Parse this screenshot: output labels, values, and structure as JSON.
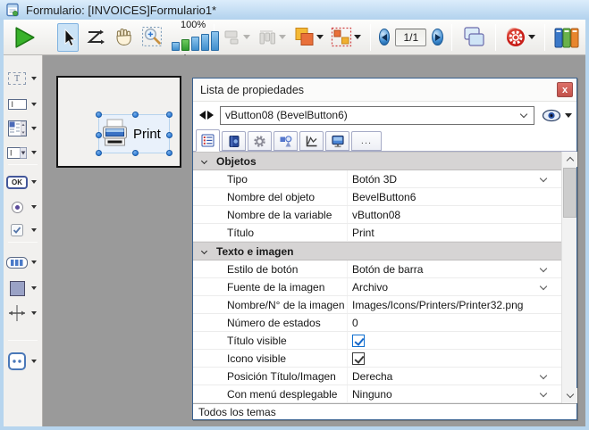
{
  "window": {
    "title": "Formulario: [INVOICES]Formulario1*"
  },
  "toolbar": {
    "zoom_level": "100%",
    "page_indicator": "1/1"
  },
  "sidebar": {
    "text_glyph": "T",
    "input_glyph": "I",
    "ok_glyph": "OK"
  },
  "canvas": {
    "button_title": "Print"
  },
  "panel": {
    "title": "Lista de propiedades",
    "close_glyph": "x",
    "selector_value": "vButton08 (BevelButton6)",
    "tabs_overflow_glyph": "...",
    "footer": "Todos los temas",
    "rows": [
      {
        "kind": "section",
        "label": "Objetos"
      },
      {
        "kind": "prop",
        "label": "Tipo",
        "value": "Botón 3D",
        "dropdown": true
      },
      {
        "kind": "prop",
        "label": "Nombre del objeto",
        "value": "BevelButton6"
      },
      {
        "kind": "prop",
        "label": "Nombre de la variable",
        "value": "vButton08"
      },
      {
        "kind": "prop",
        "label": "Título",
        "value": "Print"
      },
      {
        "kind": "section",
        "label": "Texto e imagen"
      },
      {
        "kind": "prop",
        "label": "Estilo de botón",
        "value": "Botón de barra",
        "dropdown": true
      },
      {
        "kind": "prop",
        "label": "Fuente de la imagen",
        "value": "Archivo",
        "dropdown": true
      },
      {
        "kind": "prop",
        "label": "Nombre/N° de la imagen",
        "value": "Images/Icons/Printers/Printer32.png"
      },
      {
        "kind": "prop",
        "label": "Número de estados",
        "value": "0"
      },
      {
        "kind": "prop",
        "label": "Título visible",
        "checkbox": true,
        "checked": true,
        "focused": true
      },
      {
        "kind": "prop",
        "label": "Icono visible",
        "checkbox": true,
        "checked": true
      },
      {
        "kind": "prop",
        "label": "Posición Título/Imagen",
        "value": "Derecha",
        "dropdown": true
      },
      {
        "kind": "prop",
        "label": "Con menú desplegable",
        "value": "Ninguno",
        "dropdown": true
      }
    ]
  }
}
